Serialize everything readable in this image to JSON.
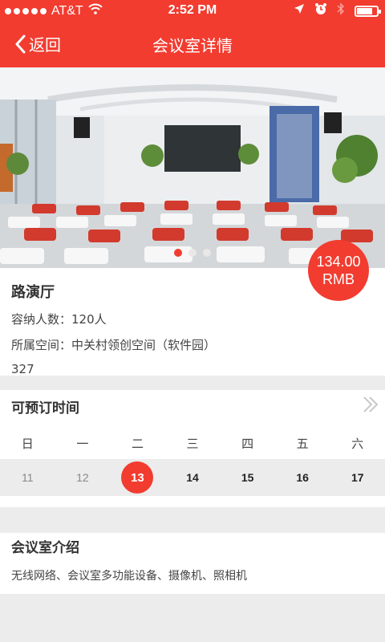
{
  "status_bar": {
    "carrier": "AT&T",
    "time": "2:52 PM",
    "signal_dots": 5,
    "battery_level": 0.8,
    "icons": [
      "wifi-icon",
      "location-icon",
      "alarm-icon",
      "bluetooth-icon",
      "battery-icon"
    ]
  },
  "nav": {
    "back_label": "返回",
    "title": "会议室详情"
  },
  "hero": {
    "image_count": 3,
    "active_index": 0,
    "price_value": "134.00",
    "price_unit": "RMB"
  },
  "room": {
    "name": "路演厅",
    "capacity": "容纳人数：120人",
    "space": "所属空间：中关村领创空间（软件园）",
    "room_number": "327"
  },
  "booking": {
    "title": "可预订时间",
    "weekdays": [
      "日",
      "一",
      "二",
      "三",
      "四",
      "五",
      "六"
    ],
    "days": [
      "11",
      "12",
      "13",
      "14",
      "15",
      "16",
      "17"
    ],
    "selected_day": "13"
  },
  "intro": {
    "title": "会议室介绍",
    "text": "无线网络、会议室多功能设备、摄像机、照相机"
  },
  "colors": {
    "accent": "#f23c30",
    "background": "#ececec"
  }
}
